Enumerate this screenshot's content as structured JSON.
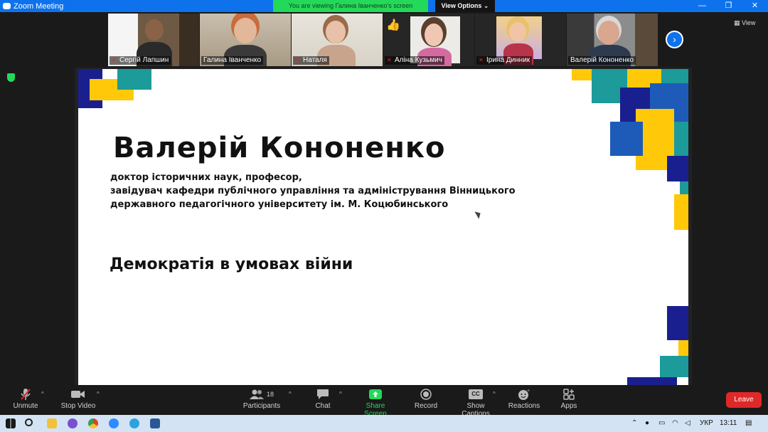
{
  "window": {
    "title": "Zoom Meeting",
    "viewing_banner": "You are viewing Галина Іванченко's screen",
    "view_options": "View Options ⌄",
    "view_label": "View",
    "controls": {
      "minimize": "—",
      "restore": "❐",
      "close": "✕"
    }
  },
  "participants": [
    {
      "name": "Сергій Лапшин",
      "muted": true
    },
    {
      "name": "Галина Іванченко",
      "muted": false,
      "active": true
    },
    {
      "name": "Наталя",
      "muted": true
    },
    {
      "name": "Аліна Кузьмич",
      "muted": true,
      "reaction": "👍"
    },
    {
      "name": "Ірина  Динник",
      "muted": true
    },
    {
      "name": "Валерій Кононенко",
      "muted": false
    }
  ],
  "slide": {
    "speaker_name": "Валерій Кононенко",
    "credentials_line1": "доктор історичних наук, професор,",
    "credentials_line2": "завідувач кафедри публічного управління та адміністрування Вінницького",
    "credentials_line3": "державного педагогічного університету ім. М. Коцюбинського",
    "topic": "Демократія в умовах війни",
    "colors": {
      "navy": "#1a1f8f",
      "teal": "#1d9a9a",
      "yellow": "#ffc90a",
      "blue": "#1e5bb8"
    }
  },
  "toolbar": {
    "unmute": "Unmute",
    "stop_video": "Stop Video",
    "participants": "Participants",
    "participants_count": "18",
    "chat": "Chat",
    "share_screen": "Share Screen",
    "record": "Record",
    "show_captions": "Show Captions",
    "reactions": "Reactions",
    "apps": "Apps",
    "leave": "Leave"
  },
  "taskbar": {
    "language": "УКР",
    "time": "13:11"
  }
}
